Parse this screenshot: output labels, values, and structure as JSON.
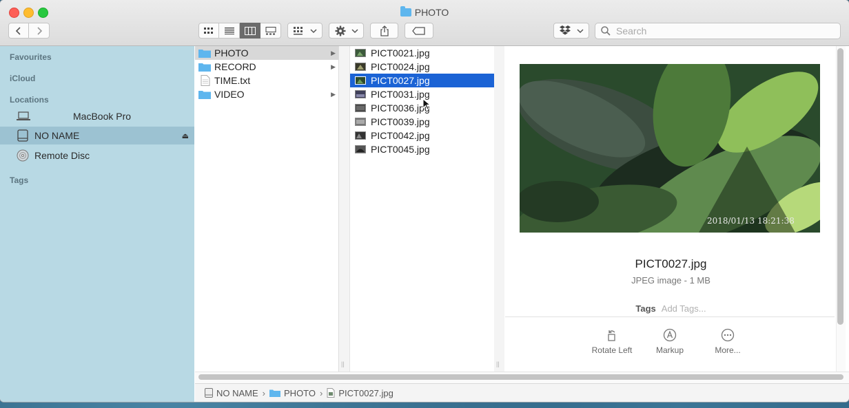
{
  "window": {
    "title": "PHOTO"
  },
  "toolbar": {
    "search_placeholder": "Search",
    "view_modes": [
      "icon-view",
      "list-view",
      "column-view",
      "gallery-view"
    ],
    "active_view": "column-view"
  },
  "sidebar": {
    "sections": {
      "favourites": "Favourites",
      "icloud": "iCloud",
      "locations": "Locations",
      "tags": "Tags"
    },
    "locations": [
      {
        "label": "MacBook Pro",
        "icon": "laptop-icon"
      },
      {
        "label": "NO NAME",
        "icon": "drive-icon",
        "selected": true
      },
      {
        "label": "Remote Disc",
        "icon": "disc-icon"
      }
    ]
  },
  "columns": {
    "root": [
      {
        "label": "PHOTO",
        "type": "folder",
        "selected": true
      },
      {
        "label": "RECORD",
        "type": "folder"
      },
      {
        "label": "TIME.txt",
        "type": "file"
      },
      {
        "label": "VIDEO",
        "type": "folder"
      }
    ],
    "photo": [
      {
        "label": "PICT0021.jpg"
      },
      {
        "label": "PICT0024.jpg"
      },
      {
        "label": "PICT0027.jpg",
        "selected": true
      },
      {
        "label": "PICT0031.jpg"
      },
      {
        "label": "PICT0036.jpg"
      },
      {
        "label": "PICT0039.jpg"
      },
      {
        "label": "PICT0042.jpg"
      },
      {
        "label": "PICT0045.jpg"
      }
    ]
  },
  "preview": {
    "file_name": "PICT0027.jpg",
    "meta": "JPEG image - 1 MB",
    "timestamp_overlay": "2018/01/13 18:21:38",
    "tags_label": "Tags",
    "tags_placeholder": "Add Tags...",
    "actions": [
      {
        "label": "Rotate Left",
        "icon": "rotate-left-icon"
      },
      {
        "label": "Markup",
        "icon": "markup-icon"
      },
      {
        "label": "More...",
        "icon": "more-icon"
      }
    ]
  },
  "pathbar": [
    "NO NAME",
    "PHOTO",
    "PICT0027.jpg"
  ]
}
